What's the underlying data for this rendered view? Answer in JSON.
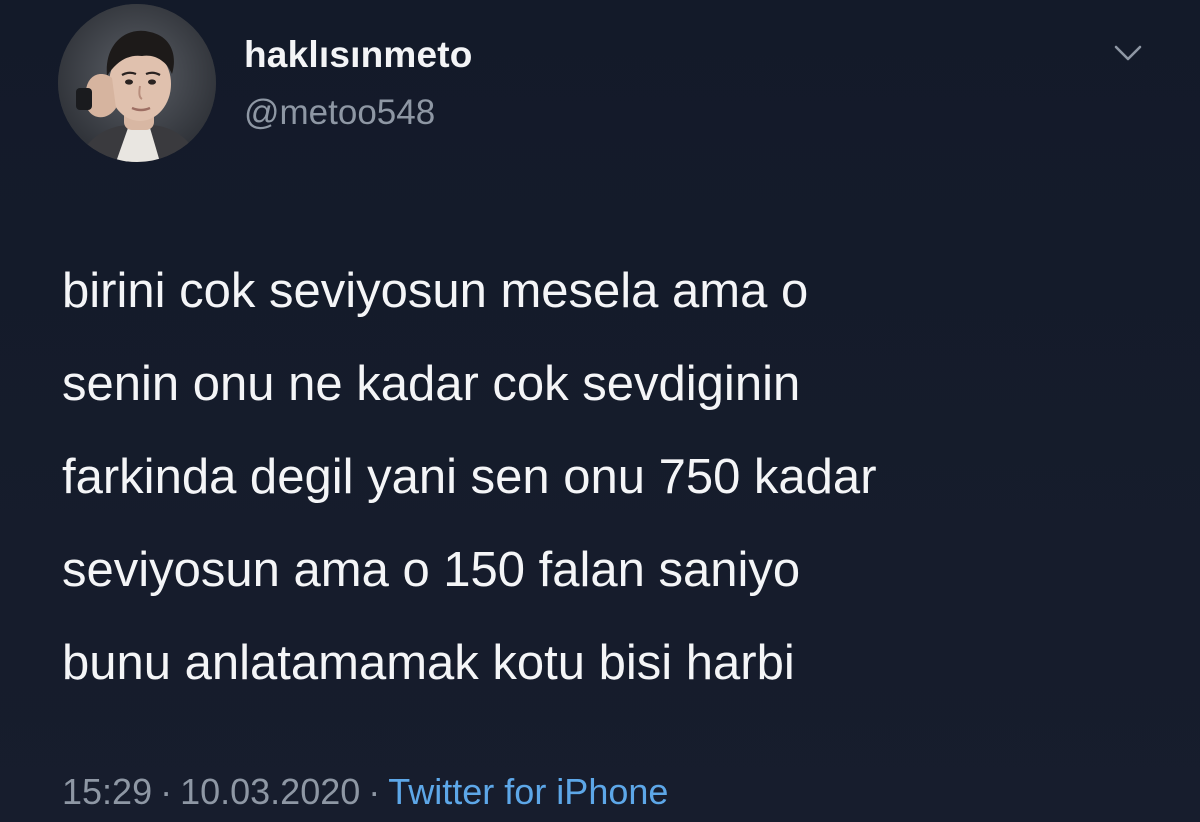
{
  "tweet": {
    "display_name": "haklısınmeto",
    "handle": "@metoo548",
    "lines": [
      "birini cok seviyosun mesela ama o",
      "senin onu ne kadar cok sevdiginin",
      "farkinda degil yani sen onu 750 kadar",
      "seviyosun ama o 150 falan saniyo",
      "bunu anlatamamak kotu bisi harbi"
    ],
    "time": "15:29",
    "date": "10.03.2020",
    "separator": "·",
    "source": "Twitter for iPhone"
  },
  "icons": {
    "avatar": "profile-photo",
    "menu": "chevron-down-icon"
  },
  "colors": {
    "background": "#151b2b",
    "text_primary": "#f4f5f7",
    "text_secondary": "#8e97a4",
    "link": "#5da7e8"
  }
}
